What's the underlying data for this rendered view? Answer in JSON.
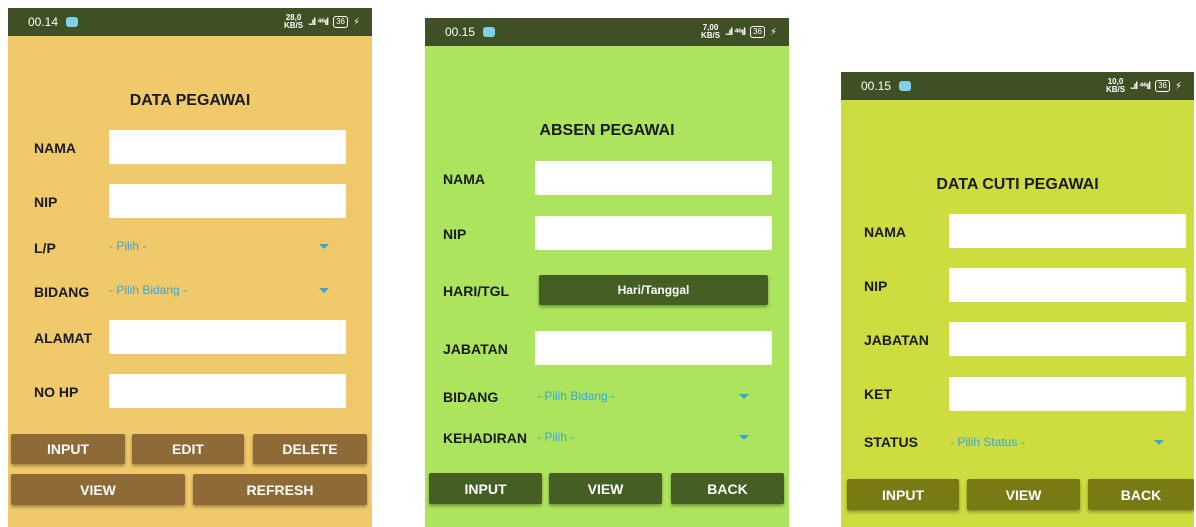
{
  "colors": {
    "statusbar": "#3f5124",
    "phone1_bg": "#f0c96b",
    "phone2_bg": "#ade45d",
    "phone3_bg": "#cddc3f",
    "phone1_button": "#8e6a37",
    "phone2_button": "#445e24",
    "phone3_button": "#7a7a14",
    "spinner_text": "#3aa6d6"
  },
  "phone1": {
    "status": {
      "time": "00.14",
      "net_top": "28,0",
      "net_bottom": "KB/S",
      "signal": "..ıl ⁴⁶ıl",
      "battery": "36"
    },
    "title": "DATA PEGAWAI",
    "labels": {
      "nama": "NAMA",
      "nip": "NIP",
      "lp": "L/P",
      "bidang": "BIDANG",
      "alamat": "ALAMAT",
      "nohp": "NO HP"
    },
    "spinners": {
      "lp": "- Pilih -",
      "bidang": "- Pilih Bidang -"
    },
    "buttons": {
      "input": "INPUT",
      "edit": "EDIT",
      "delete": "DELETE",
      "view": "VIEW",
      "refresh": "REFRESH"
    }
  },
  "phone2": {
    "status": {
      "time": "00.15",
      "net_top": "7,00",
      "net_bottom": "KB/S",
      "signal": "..ıl ⁴⁶ıl",
      "battery": "36"
    },
    "title": "ABSEN PEGAWAI",
    "labels": {
      "nama": "NAMA",
      "nip": "NIP",
      "haritgl": "HARI/TGL",
      "jabatan": "JABATAN",
      "bidang": "BIDANG",
      "kehadiran": "KEHADIRAN"
    },
    "date_button": "Hari/Tanggal",
    "spinners": {
      "bidang": "- Pilih Bidang -",
      "kehadiran": "- Pilih -"
    },
    "buttons": {
      "input": "INPUT",
      "view": "VIEW",
      "back": "BACK"
    }
  },
  "phone3": {
    "status": {
      "time": "00.15",
      "net_top": "10,0",
      "net_bottom": "KB/S",
      "signal": "..ıl ⁴⁶ıl",
      "battery": "36"
    },
    "title": "DATA CUTI PEGAWAI",
    "labels": {
      "nama": "NAMA",
      "nip": "NIP",
      "jabatan": "JABATAN",
      "ket": "KET",
      "status": "STATUS"
    },
    "spinners": {
      "status": "- Pilih Status -"
    },
    "buttons": {
      "input": "INPUT",
      "view": "VIEW",
      "back": "BACK"
    }
  }
}
